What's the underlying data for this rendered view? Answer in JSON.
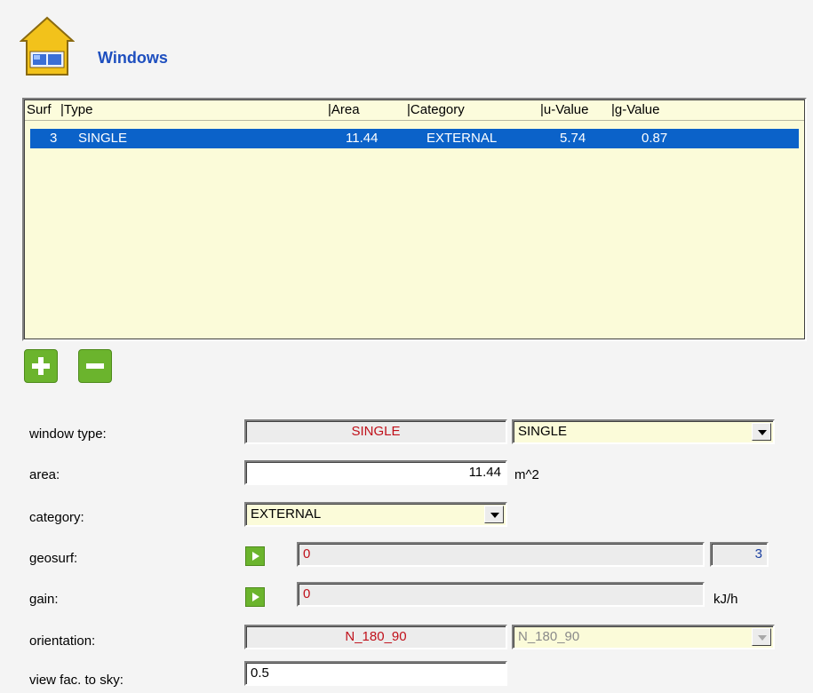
{
  "section": {
    "title": "Windows"
  },
  "table": {
    "columns": [
      "Surf",
      "|Type",
      "|Area",
      "|Category",
      "|u-Value",
      "|g-Value"
    ],
    "rows": [
      {
        "surf": "3",
        "type": "SINGLE",
        "area": "11.44",
        "category": "EXTERNAL",
        "u_value": "5.74",
        "g_value": "0.87",
        "selected": true
      }
    ]
  },
  "form": {
    "window_type": {
      "label": "window type:",
      "value": "SINGLE",
      "select": "SINGLE"
    },
    "area": {
      "label": "area:",
      "value": "11.44",
      "unit": "m^2"
    },
    "category": {
      "label": "category:",
      "select": "EXTERNAL"
    },
    "geosurf": {
      "label": "geosurf:",
      "value": "0",
      "count": "3"
    },
    "gain": {
      "label": "gain:",
      "value": "0",
      "unit": "kJ/h"
    },
    "orientation": {
      "label": "orientation:",
      "value": "N_180_90",
      "select": "N_180_90"
    },
    "view_fac": {
      "label": "view fac. to sky:",
      "value": "0.5"
    }
  },
  "colors": {
    "accent_green": "#6bb42d",
    "selection_blue": "#0b62c9",
    "title_blue": "#1e4fbf",
    "value_red": "#c0101a",
    "field_cream": "#fbfbd9"
  },
  "icons": [
    "house-window-icon",
    "add-icon",
    "remove-icon",
    "play-icon",
    "chevron-down-icon"
  ]
}
